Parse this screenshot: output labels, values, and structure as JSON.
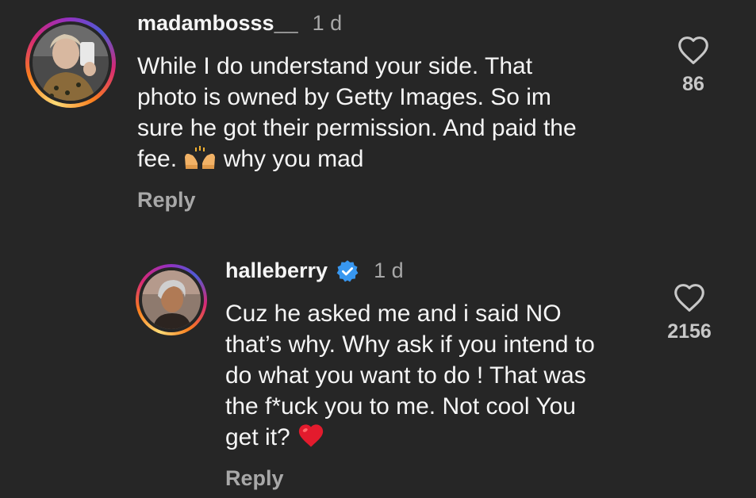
{
  "comments": [
    {
      "username": "madambosss__",
      "time": "1 d",
      "text": "While I do understand your side.  That\nphoto is owned by Getty Images. So im\nsure he got their permission. And paid the\nfee. ",
      "text_tail": " why you mad",
      "emoji": "raising-hands-emoji",
      "reply": "Reply",
      "likes": "86"
    },
    {
      "username": "halleberry",
      "verified": true,
      "time": "1 d",
      "text": "Cuz he asked me and i said NO\nthat’s why. Why ask if you intend to\ndo what you want to do ! That was\nthe f*uck you to me. Not cool You\nget it? ",
      "emoji": "red-heart-emoji",
      "reply": "Reply",
      "likes": "2156"
    }
  ],
  "colors": {
    "background": "#262626",
    "verified_blue": "#3897f0",
    "heart_red": "#e0245e",
    "muted_text": "#a8a8a8"
  }
}
